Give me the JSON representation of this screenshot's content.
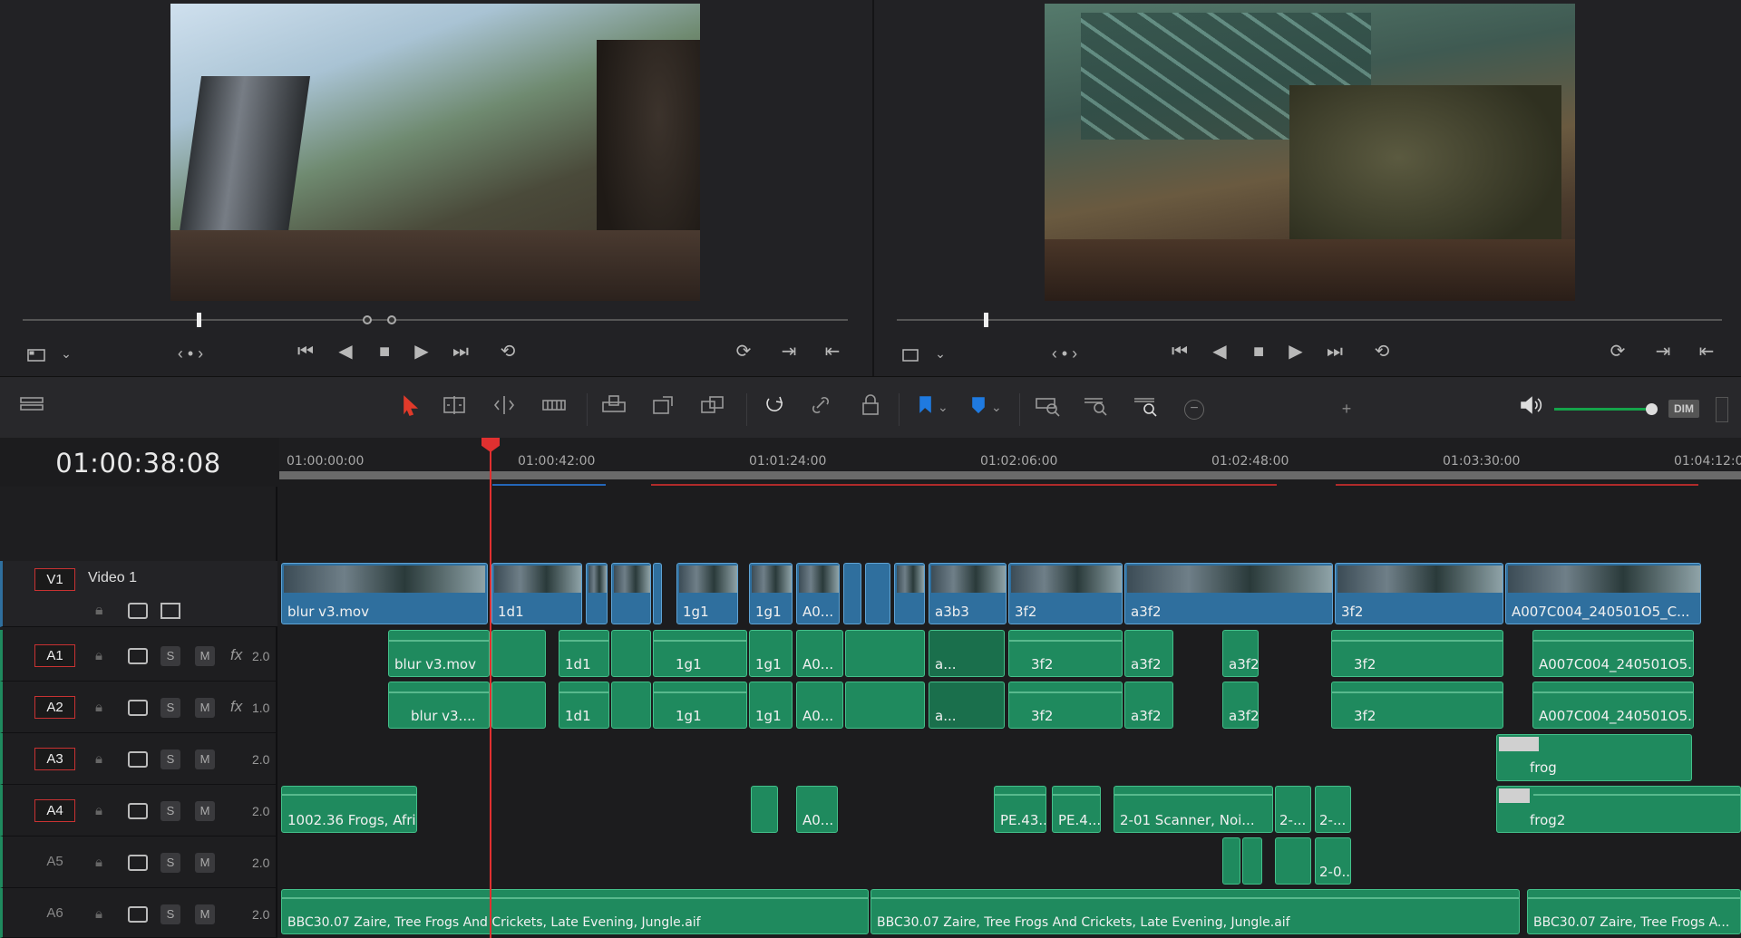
{
  "source_viewer": {
    "frame_colors": [
      "#8fb0c8",
      "#5a6a55",
      "#3b2f28"
    ],
    "zoom_icon": "viewer-size-icon"
  },
  "timeline_viewer": {
    "frame_colors": [
      "#4e7a6e",
      "#5d4a37",
      "#2b3b2a"
    ]
  },
  "timecode": "01:00:38:08",
  "ruler": {
    "labels": [
      "01:00:00:00",
      "01:00:42:00",
      "01:01:24:00",
      "01:02:06:00",
      "01:02:48:00",
      "01:03:30:00",
      "01:04:12:0"
    ]
  },
  "toolbar": {
    "dim_label": "DIM"
  },
  "tracks": {
    "v1": {
      "name": "V1",
      "title": "Video 1"
    },
    "a1": {
      "name": "A1",
      "vol": "2.0",
      "fx": "fx"
    },
    "a2": {
      "name": "A2",
      "vol": "1.0",
      "fx": "fx"
    },
    "a3": {
      "name": "A3",
      "vol": "2.0"
    },
    "a4": {
      "name": "A4",
      "vol": "2.0"
    },
    "a5": {
      "name": "A5",
      "vol": "2.0"
    },
    "a6": {
      "name": "A6",
      "vol": "2.0"
    },
    "solo": "S",
    "mute": "M"
  },
  "clips": {
    "v1": [
      "blur v3.mov",
      "1d1",
      "1g1",
      "1g1",
      "A0...",
      "a3b3",
      "3f2",
      "a3f2",
      "3f2",
      "A007C004_240501O5_C..."
    ],
    "a1": [
      "blur v3.mov",
      "1d1",
      "1g1",
      "1g1",
      "A0...",
      "a...",
      "3f2",
      "a3f2",
      "a3f2",
      "3f2",
      "A007C004_240501O5..."
    ],
    "a2": [
      "blur v3....",
      "1d1",
      "1g1",
      "1g1",
      "A0...",
      "a...",
      "3f2",
      "a3f2",
      "a3f2",
      "3f2",
      "A007C004_240501O5..."
    ],
    "a3": [
      "frog"
    ],
    "a4": [
      "1002.36 Frogs, Afri...",
      "A0...",
      "PE.43...",
      "PE.4...",
      "2-01 Scanner, Noi...",
      "2-...",
      "2-...",
      "frog2"
    ],
    "a5": [
      "2-0..."
    ],
    "a6": [
      "BBC30.07 Zaire, Tree Frogs And Crickets, Late Evening, Jungle.aif",
      "BBC30.07 Zaire, Tree Frogs And Crickets, Late Evening, Jungle.aif",
      "BBC30.07 Zaire, Tree Frogs A..."
    ]
  }
}
